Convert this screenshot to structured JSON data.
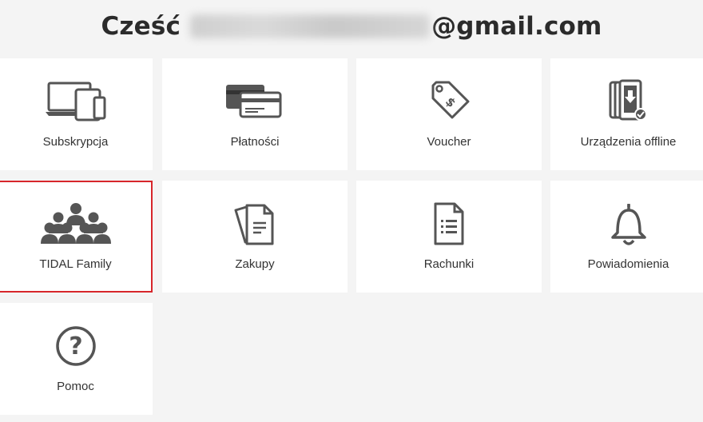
{
  "header": {
    "greeting_prefix": "Cześć",
    "email_domain": "@gmail.com"
  },
  "tiles": [
    {
      "label": "Subskrypcja",
      "icon": "devices-icon",
      "selected": false
    },
    {
      "label": "Płatności",
      "icon": "credit-cards-icon",
      "selected": false
    },
    {
      "label": "Voucher",
      "icon": "price-tag-icon",
      "selected": false
    },
    {
      "label": "Urządzenia offline",
      "icon": "offline-devices-icon",
      "selected": false
    },
    {
      "label": "TIDAL Family",
      "icon": "family-icon",
      "selected": true
    },
    {
      "label": "Zakupy",
      "icon": "documents-icon",
      "selected": false
    },
    {
      "label": "Rachunki",
      "icon": "receipt-icon",
      "selected": false
    },
    {
      "label": "Powiadomienia",
      "icon": "bell-icon",
      "selected": false
    },
    {
      "label": "Pomoc",
      "icon": "help-icon",
      "selected": false
    }
  ],
  "colors": {
    "selected_border": "#d7262b",
    "icon": "#555555",
    "background": "#f4f4f4",
    "tile": "#ffffff"
  }
}
